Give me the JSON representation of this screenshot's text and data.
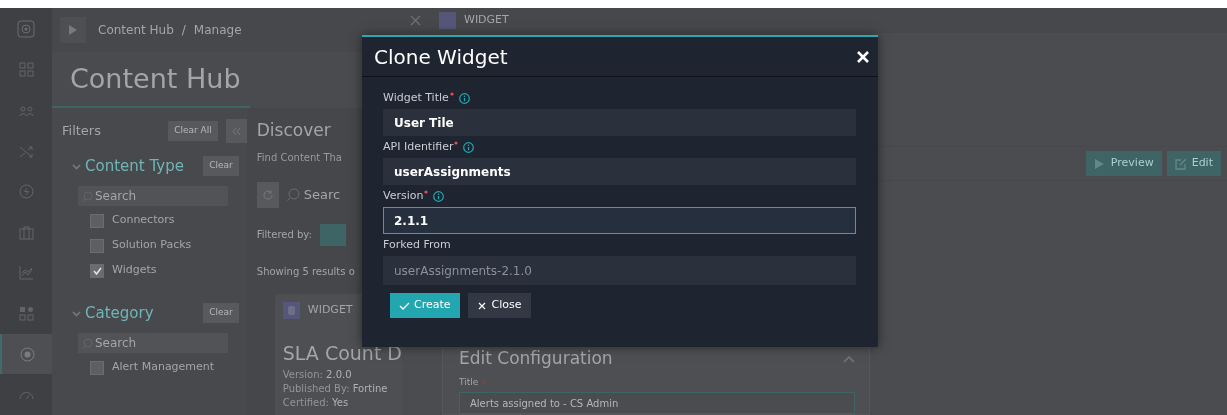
{
  "top_bar": {
    "breadcrumb": [
      "Content Hub",
      "Manage"
    ],
    "separator": "/"
  },
  "rail": {
    "items": [
      {
        "kind": "dashboard",
        "selected": false
      },
      {
        "kind": "people",
        "selected": false
      },
      {
        "kind": "shuffle",
        "selected": false
      },
      {
        "kind": "bolt",
        "selected": false
      },
      {
        "kind": "briefcase",
        "selected": false
      },
      {
        "kind": "chart",
        "selected": false
      },
      {
        "kind": "apps",
        "selected": false
      },
      {
        "kind": "hub",
        "selected": true
      },
      {
        "kind": "gauge",
        "selected": false
      }
    ]
  },
  "page_title": "Content Hub",
  "filters": {
    "title": "Filters",
    "clear_all": "Clear All",
    "sections": [
      {
        "title": "Content Type",
        "expanded": true,
        "clear": "Clear",
        "search_placeholder": "Search",
        "options": [
          {
            "label": "Connectors",
            "checked": false
          },
          {
            "label": "Solution Packs",
            "checked": false
          },
          {
            "label": "Widgets",
            "checked": true
          }
        ]
      },
      {
        "title": "Category",
        "expanded": true,
        "clear": "Clear",
        "search_placeholder": "Search",
        "options": [
          {
            "label": "Alert Management",
            "checked": false
          }
        ]
      }
    ]
  },
  "discover": {
    "title": "Discover",
    "subtitle": "Find Content Tha",
    "search_placeholder": "Searc",
    "filtered_by": "Filtered by:",
    "results": "Showing 5 results o",
    "card": {
      "type": "WIDGET",
      "title": "SLA Count D",
      "meta": [
        {
          "label": "Version:",
          "value": "2.0.0"
        },
        {
          "label": "Published By:",
          "value": "Fortine"
        },
        {
          "label": "Certified:",
          "value": "Yes"
        }
      ]
    }
  },
  "drawer": {
    "type": "WIDGET",
    "buttons": [
      {
        "kind": "preview",
        "label": "Preview"
      },
      {
        "kind": "edit",
        "label": "Edit"
      }
    ],
    "edit_config": {
      "title": "Edit Configuration",
      "expanded": true,
      "fields": [
        {
          "label": "Title",
          "required": true,
          "value": "Alerts assigned to - CS Admin"
        }
      ]
    }
  },
  "modal": {
    "title": "Clone Widget",
    "fields": [
      {
        "label": "Widget Title",
        "required": true,
        "info": true,
        "value": "User Tile",
        "focused": false,
        "disabled": false
      },
      {
        "label": "API Identifier",
        "required": true,
        "info": true,
        "value": "userAssignments",
        "focused": false,
        "disabled": false
      },
      {
        "label": "Version",
        "required": true,
        "info": true,
        "value": "2.1.1",
        "focused": true,
        "disabled": false
      },
      {
        "label": "Forked From",
        "required": false,
        "info": false,
        "value": "userAssignments-2.1.0",
        "focused": false,
        "disabled": true
      }
    ],
    "buttons": [
      {
        "kind": "primary",
        "label": "Create"
      },
      {
        "kind": "secondary",
        "label": "Close"
      }
    ]
  }
}
